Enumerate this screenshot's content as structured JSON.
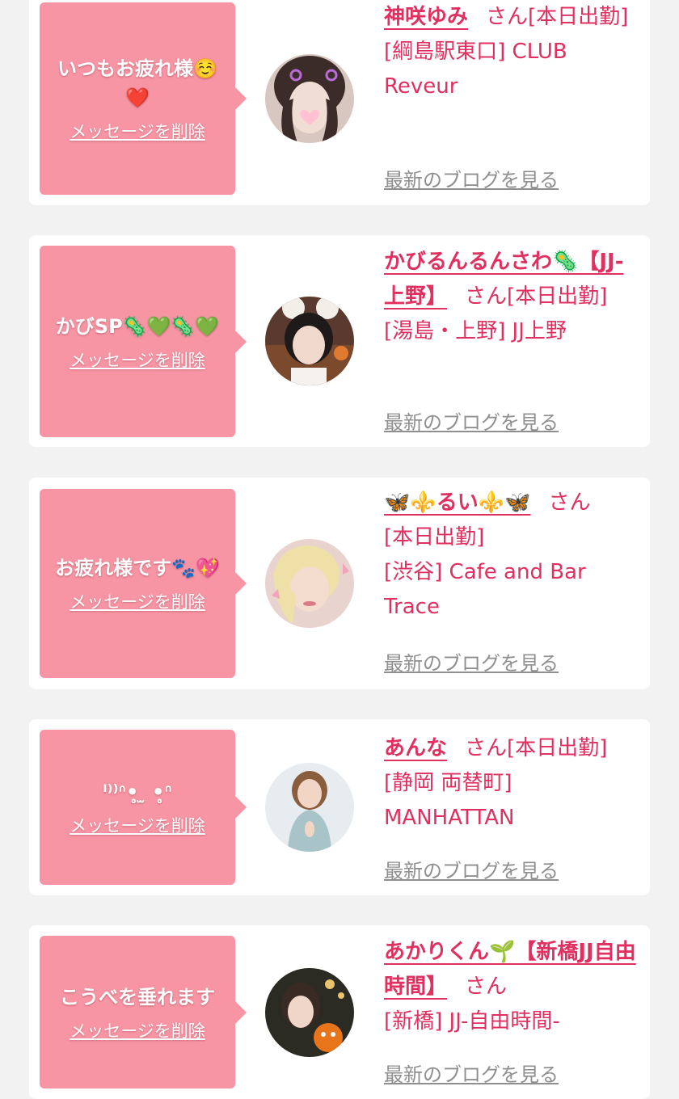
{
  "common": {
    "delete_label": "メッセージを削除",
    "blog_label": "最新のブログを見る",
    "san_label": "さん",
    "bubble_color": "#f895a4",
    "accent_color": "#e0305f"
  },
  "cards": [
    {
      "message": "いつもお疲れ様☺️❤️",
      "name": "神咲ゆみ",
      "after_san": "[本日出勤]",
      "location": "[綱島駅東口] CLUB Reveur"
    },
    {
      "message": "かびSP🦠💚🦠💚",
      "name": "かびるんるんさわ🦠【JJ-上野】",
      "after_san": "[本日出勤]",
      "location": "[湯島・上野] JJ上野"
    },
    {
      "message": "お疲れ様です🐾💖",
      "name": "🦋⚜️るい⚜️🦋",
      "after_san": "[本日出勤]",
      "location": "[渋谷] Cafe and Bar Trace"
    },
    {
      "message": "ᑊ⁾⁾ᐢ•̥ ̫ •̥ᐢ",
      "name": "あんな",
      "after_san": "[本日出勤]",
      "location": "[静岡 両替町] MANHATTAN"
    },
    {
      "message": "こうべを垂れます",
      "name": "あかりくん🌱【新橋JJ自由時間】",
      "after_san": "",
      "location": "[新橋] JJ-自由時間-"
    }
  ]
}
